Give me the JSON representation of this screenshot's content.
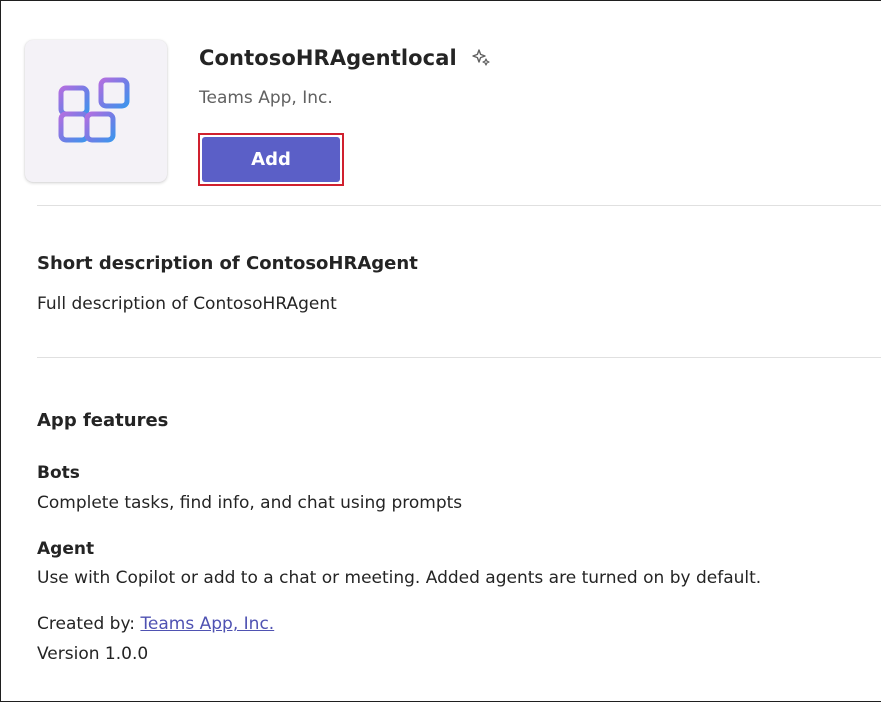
{
  "app": {
    "name": "ContosoHRAgentlocal",
    "publisher": "Teams App, Inc.",
    "add_label": "Add",
    "icon": "app-grid-icon",
    "badge_icon": "copilot-sparkle-icon"
  },
  "description": {
    "short": "Short description of ContosoHRAgent",
    "full": "Full description of ContosoHRAgent"
  },
  "features": {
    "heading": "App features",
    "items": [
      {
        "title": "Bots",
        "desc": "Complete tasks, find info, and chat using prompts"
      },
      {
        "title": "Agent",
        "desc": "Use with Copilot or add to a chat or meeting. Added agents are turned on by default."
      }
    ]
  },
  "footer": {
    "created_by_label": "Created by:",
    "created_by_link": "Teams App, Inc.",
    "version": "Version 1.0.0"
  },
  "colors": {
    "accent": "#5b5fc7",
    "highlight_outline": "#d0202e",
    "link": "#4f52b2",
    "icon_gradient_start": "#a56de0",
    "icon_gradient_end": "#4f8fe8"
  }
}
